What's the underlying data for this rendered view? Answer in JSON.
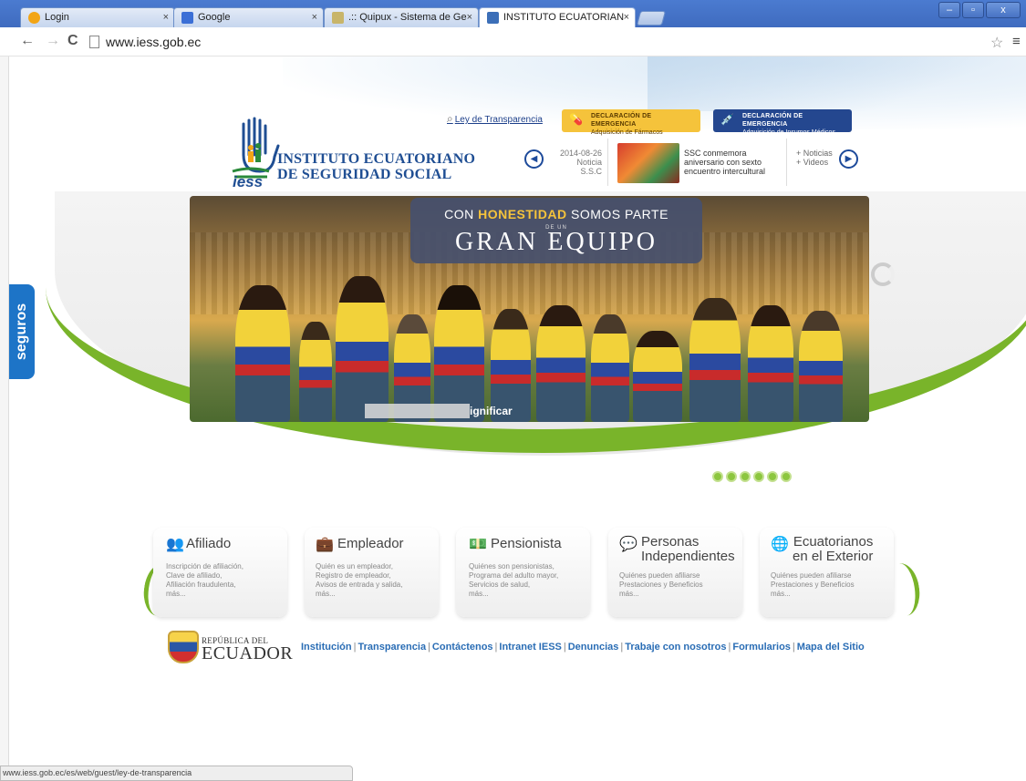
{
  "browser": {
    "tabs": [
      {
        "title": "Login",
        "favicon_color": "#f2a516",
        "active": false
      },
      {
        "title": "Google",
        "favicon_color": "#3b6fd6",
        "active": false
      },
      {
        "title": ".:: Quipux - Sistema de Ge",
        "favicon_color": "#c8b56a",
        "active": false
      },
      {
        "title": "INSTITUTO ECUATORIAN",
        "favicon_color": "#3c6fb8",
        "active": true
      }
    ],
    "tab_close_glyph": "×",
    "window_buttons": {
      "minimize": "–",
      "maximize": "▫",
      "close": "x"
    },
    "url": "www.iess.gob.ec",
    "status_url": "www.iess.gob.ec/es/web/guest/ley-de-transparencia"
  },
  "header": {
    "institution_line1": "INSTITUTO ECUATORIANO",
    "institution_line2": "DE SEGURIDAD SOCIAL",
    "logo_text": "iess",
    "transparencia_link": "Ley de Transparencia",
    "emergency_buttons": [
      {
        "title": "DECLARACIÓN DE EMERGENCIA",
        "subtitle": "Adquisición de Fármacos",
        "color": "#f5c33b"
      },
      {
        "title": "DECLARACIÓN DE EMERGENCIA",
        "subtitle": "Adquisición de Insumos Médicos",
        "color": "#24478f"
      }
    ]
  },
  "news": {
    "date": "2014-08-26",
    "type": "Noticia",
    "source": "S.S.C",
    "headline_l1": "SSC conmemora",
    "headline_l2": "aniversario con sexto",
    "headline_l3": "encuentro intercultural",
    "link_noticias": "+ Noticias",
    "link_videos": "+ Videos"
  },
  "hero": {
    "line1_pre": "CON ",
    "line1_accent": "HONESTIDAD",
    "line1_post": " SOMOS PARTE",
    "line2": "DE UN",
    "line3": "GRAN EQUIPO",
    "caption": "ignificar",
    "slide_count": 6,
    "accent_color": "#79b42a"
  },
  "side_tab": "seguros",
  "cards": [
    {
      "title": "Afiliado",
      "icon": "people-icon",
      "glyph": "👥",
      "lines": [
        "Inscripción de afiliación,",
        "Clave de afiliado,",
        "Afiliación fraudulenta,",
        "más..."
      ]
    },
    {
      "title": "Empleador",
      "icon": "briefcase-icon",
      "glyph": "💼",
      "lines": [
        "Quién es un empleador,",
        "Registro de empleador,",
        "Avisos de entrada y salida,",
        "más..."
      ]
    },
    {
      "title": "Pensionista",
      "icon": "money-icon",
      "glyph": "💵",
      "lines": [
        "Quiénes son pensionistas,",
        "Programa del adulto mayor,",
        "Servicios de salud,",
        "más..."
      ]
    },
    {
      "title_l1": "Personas",
      "title_l2": "Independientes",
      "icon": "chat-icon",
      "glyph": "💬",
      "lines": [
        "Quiénes pueden afiliarse",
        "Prestaciones y Beneficios",
        "más..."
      ]
    },
    {
      "title_l1": "Ecuatorianos",
      "title_l2": "en el Exterior",
      "icon": "globe-icon",
      "glyph": "🌐",
      "lines": [
        "Quiénes pueden afiliarse",
        "Prestaciones y Beneficios",
        "más..."
      ]
    }
  ],
  "footer": {
    "republica": "REPÚBLICA DEL",
    "ecuador": "ECUADOR",
    "links": [
      "Institución",
      "Transparencia",
      "Contáctenos",
      "Intranet IESS",
      "Denuncias",
      "Trabaje con nosotros",
      "Formularios",
      "Mapa del Sitio"
    ]
  }
}
